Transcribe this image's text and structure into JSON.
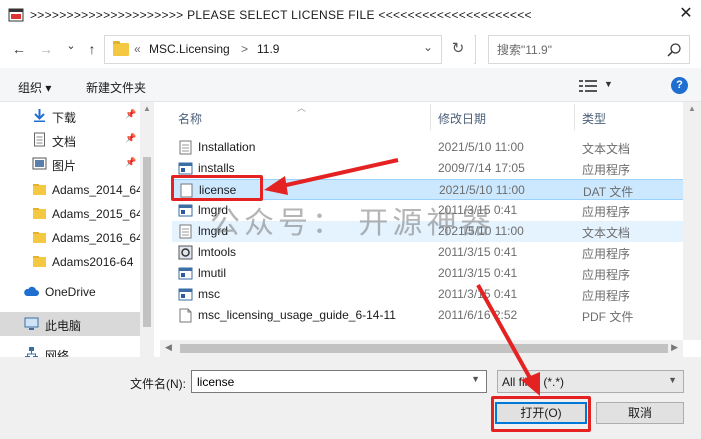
{
  "window": {
    "title": ">>>>>>>>>>>>>>>>>>>>>  PLEASE SELECT LICENSE FILE  <<<<<<<<<<<<<<<<<<<<<",
    "close_glyph": "✕"
  },
  "nav": {
    "back_glyph": "←",
    "forward_glyph": "→",
    "dropdown_glyph": "⌄",
    "up_glyph": "↑",
    "breadcrumb": [
      "«",
      "MSC.Licensing",
      ">",
      "11.9"
    ],
    "address_dropdown_glyph": "⌄",
    "refresh_glyph": "↻",
    "search_placeholder": "搜索\"11.9\""
  },
  "toolbar": {
    "organize": "组织 ▾",
    "new_folder": "新建文件夹",
    "help": "?"
  },
  "sidebar": {
    "items": [
      {
        "label": "下载",
        "icon": "download-icon",
        "pinned": true
      },
      {
        "label": "文档",
        "icon": "document-icon",
        "pinned": true
      },
      {
        "label": "图片",
        "icon": "picture-icon",
        "pinned": true
      },
      {
        "label": "Adams_2014_64",
        "icon": "folder-icon",
        "pinned": false
      },
      {
        "label": "Adams_2015_64",
        "icon": "folder-icon",
        "pinned": false
      },
      {
        "label": "Adams_2016_64",
        "icon": "folder-icon",
        "pinned": false
      },
      {
        "label": "Adams2016-64",
        "icon": "folder-icon",
        "pinned": false
      },
      {
        "label": "OneDrive",
        "icon": "cloud-icon",
        "pinned": false
      },
      {
        "label": "此电脑",
        "icon": "computer-icon",
        "pinned": false
      },
      {
        "label": "网络",
        "icon": "network-icon",
        "pinned": false
      }
    ]
  },
  "filelist": {
    "columns": {
      "name": "名称",
      "date": "修改日期",
      "type": "类型"
    },
    "rows": [
      {
        "name": "Installation",
        "date": "2021/5/10 11:00",
        "type": "文本文档",
        "icon": "text-file-icon"
      },
      {
        "name": "installs",
        "date": "2009/7/14 17:05",
        "type": "应用程序",
        "icon": "app-icon"
      },
      {
        "name": "license",
        "date": "2021/5/10 11:00",
        "type": "DAT 文件",
        "icon": "dat-file-icon"
      },
      {
        "name": "lmgrd",
        "date": "2011/3/15 0:41",
        "type": "应用程序",
        "icon": "app-icon"
      },
      {
        "name": "lmgrd",
        "date": "2021/5/10 11:00",
        "type": "文本文档",
        "icon": "text-file-icon"
      },
      {
        "name": "lmtools",
        "date": "2011/3/15 0:41",
        "type": "应用程序",
        "icon": "tools-app-icon"
      },
      {
        "name": "lmutil",
        "date": "2011/3/15 0:41",
        "type": "应用程序",
        "icon": "app-icon"
      },
      {
        "name": "msc",
        "date": "2011/3/15 0:41",
        "type": "应用程序",
        "icon": "app-icon"
      },
      {
        "name": "msc_licensing_usage_guide_6-14-11",
        "date": "2011/6/16 2:52",
        "type": "PDF 文件",
        "icon": "pdf-file-icon"
      }
    ]
  },
  "bottom": {
    "filename_label": "文件名(N):",
    "filename_value": "license",
    "filetype_value": "All files (*.*)",
    "open_button": "打开(O)",
    "cancel_button": "取消"
  },
  "watermark": "公众号：  开源神器",
  "colors": {
    "selection": "#cce8ff",
    "callout": "#e52222",
    "accent": "#0078d7"
  }
}
